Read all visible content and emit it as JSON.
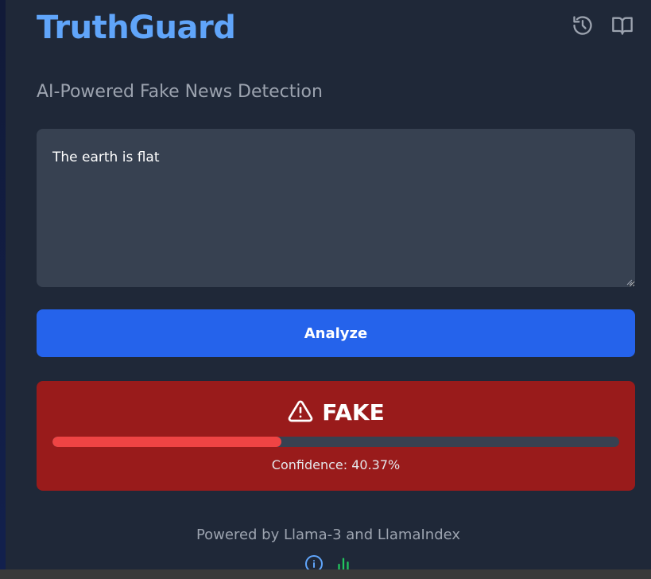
{
  "app": {
    "title": "TruthGuard",
    "subtitle": "AI-Powered Fake News Detection"
  },
  "header_icons": [
    "history-icon",
    "book-icon"
  ],
  "input": {
    "value": "The earth is flat"
  },
  "analyze_button": {
    "label": "Analyze"
  },
  "result": {
    "verdict": "FAKE",
    "confidence_label": "Confidence: 40.37%",
    "confidence": 0.4037,
    "colors": {
      "card": "#991b1b",
      "bar_fill": "#ef4444",
      "bar_track": "#374151"
    }
  },
  "footer": {
    "text": "Powered by Llama-3 and LlamaIndex",
    "icons": [
      "info-icon",
      "bar-chart-icon"
    ]
  },
  "colors": {
    "accent": "#60a5fa",
    "button": "#2563eb",
    "background": "#1f2838"
  }
}
